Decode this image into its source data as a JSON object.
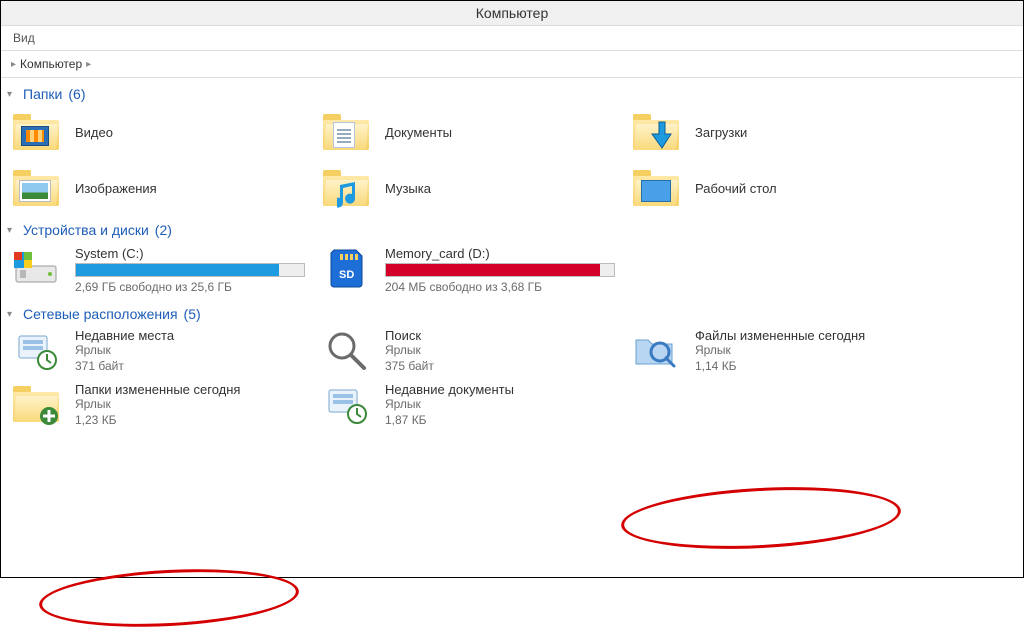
{
  "window": {
    "title": "Компьютер"
  },
  "menu": {
    "view": "Вид"
  },
  "breadcrumb": {
    "root": "Компьютер"
  },
  "sections": {
    "folders": {
      "title": "Папки",
      "count": "(6)"
    },
    "drives": {
      "title": "Устройства и диски",
      "count": "(2)"
    },
    "network": {
      "title": "Сетевые расположения",
      "count": "(5)"
    }
  },
  "folders": [
    {
      "label": "Видео"
    },
    {
      "label": "Документы"
    },
    {
      "label": "Загрузки"
    },
    {
      "label": "Изображения"
    },
    {
      "label": "Музыка"
    },
    {
      "label": "Рабочий стол"
    }
  ],
  "drives": [
    {
      "name": "System (C:)",
      "free_text": "2,69 ГБ свободно из 25,6 ГБ",
      "fill_percent": 89,
      "fill_color": "#1e9ae0"
    },
    {
      "name": "Memory_card (D:)",
      "free_text": "204 МБ свободно из 3,68 ГБ",
      "fill_percent": 94,
      "fill_color": "#d4002a"
    }
  ],
  "network": [
    {
      "name": "Недавние места",
      "type": "Ярлык",
      "size": "371 байт"
    },
    {
      "name": "Поиск",
      "type": "Ярлык",
      "size": "375 байт"
    },
    {
      "name": "Файлы измененные сегодня",
      "type": "Ярлык",
      "size": "1,14 КБ"
    },
    {
      "name": "Папки измененные сегодня",
      "type": "Ярлык",
      "size": "1,23 КБ"
    },
    {
      "name": "Недавние документы",
      "type": "Ярлык",
      "size": "1,87 КБ"
    }
  ]
}
